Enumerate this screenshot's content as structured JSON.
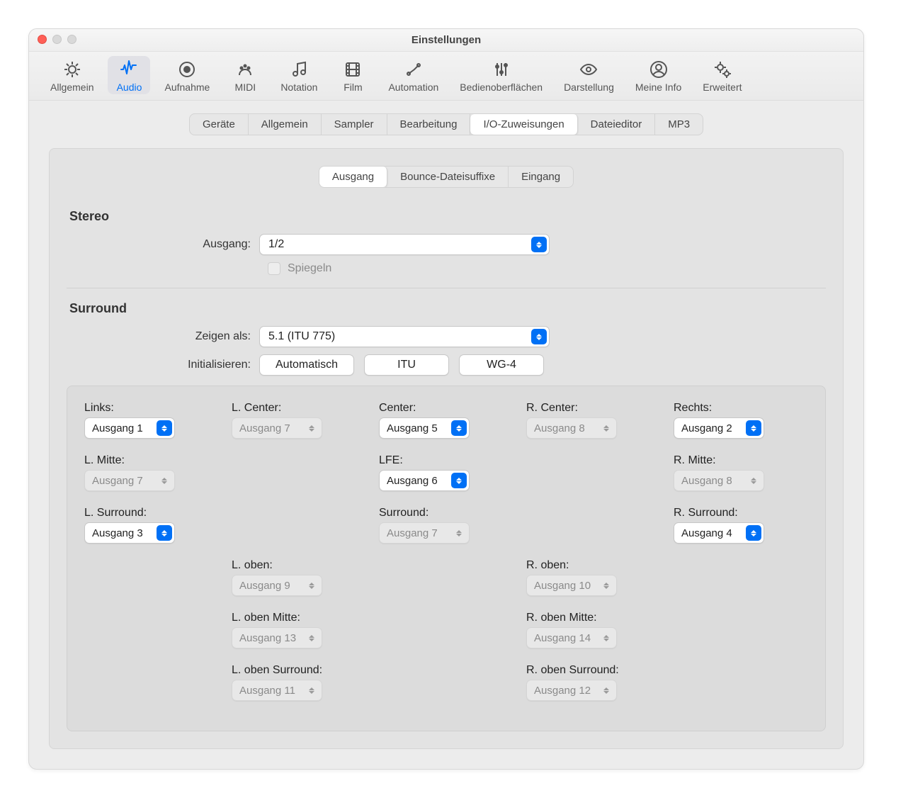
{
  "window": {
    "title": "Einstellungen"
  },
  "toolbar": [
    {
      "id": "allgemein",
      "label": "Allgemein",
      "active": false,
      "icon": "gear"
    },
    {
      "id": "audio",
      "label": "Audio",
      "active": true,
      "icon": "audio"
    },
    {
      "id": "aufnahme",
      "label": "Aufnahme",
      "active": false,
      "icon": "record"
    },
    {
      "id": "midi",
      "label": "MIDI",
      "active": false,
      "icon": "midi"
    },
    {
      "id": "notation",
      "label": "Notation",
      "active": false,
      "icon": "notes"
    },
    {
      "id": "film",
      "label": "Film",
      "active": false,
      "icon": "film"
    },
    {
      "id": "automation",
      "label": "Automation",
      "active": false,
      "icon": "automation"
    },
    {
      "id": "surfaces",
      "label": "Bedienoberflächen",
      "active": false,
      "icon": "sliders"
    },
    {
      "id": "display",
      "label": "Darstellung",
      "active": false,
      "icon": "eye"
    },
    {
      "id": "myinfo",
      "label": "Meine Info",
      "active": false,
      "icon": "user"
    },
    {
      "id": "advanced",
      "label": "Erweitert",
      "active": false,
      "icon": "gears"
    }
  ],
  "tabs1": [
    {
      "label": "Geräte",
      "active": false
    },
    {
      "label": "Allgemein",
      "active": false
    },
    {
      "label": "Sampler",
      "active": false
    },
    {
      "label": "Bearbeitung",
      "active": false
    },
    {
      "label": "I/O-Zuweisungen",
      "active": true
    },
    {
      "label": "Dateieditor",
      "active": false
    },
    {
      "label": "MP3",
      "active": false
    }
  ],
  "tabs2": [
    {
      "label": "Ausgang",
      "active": true
    },
    {
      "label": "Bounce-Dateisuffixe",
      "active": false
    },
    {
      "label": "Eingang",
      "active": false
    }
  ],
  "stereo": {
    "heading": "Stereo",
    "output_label": "Ausgang:",
    "output_value": "1/2",
    "mirror_label": "Spiegeln"
  },
  "surround": {
    "heading": "Surround",
    "show_as_label": "Zeigen als:",
    "show_as_value": "5.1 (ITU 775)",
    "init_label": "Initialisieren:",
    "init_buttons": [
      "Automatisch",
      "ITU",
      "WG-4"
    ],
    "channels": {
      "links": {
        "label": "Links:",
        "value": "Ausgang 1",
        "enabled": true
      },
      "lcenter": {
        "label": "L. Center:",
        "value": "Ausgang 7",
        "enabled": false
      },
      "center": {
        "label": "Center:",
        "value": "Ausgang 5",
        "enabled": true
      },
      "rcenter": {
        "label": "R. Center:",
        "value": "Ausgang 8",
        "enabled": false
      },
      "rechts": {
        "label": "Rechts:",
        "value": "Ausgang 2",
        "enabled": true
      },
      "lmitte": {
        "label": "L. Mitte:",
        "value": "Ausgang 7",
        "enabled": false
      },
      "lfe": {
        "label": "LFE:",
        "value": "Ausgang 6",
        "enabled": true
      },
      "rmitte": {
        "label": "R. Mitte:",
        "value": "Ausgang 8",
        "enabled": false
      },
      "lsurr": {
        "label": "L. Surround:",
        "value": "Ausgang 3",
        "enabled": true
      },
      "surr": {
        "label": "Surround:",
        "value": "Ausgang 7",
        "enabled": false
      },
      "rsurr": {
        "label": "R. Surround:",
        "value": "Ausgang 4",
        "enabled": true
      },
      "loben": {
        "label": "L. oben:",
        "value": "Ausgang 9",
        "enabled": false
      },
      "roben": {
        "label": "R. oben:",
        "value": "Ausgang 10",
        "enabled": false
      },
      "lobenm": {
        "label": "L. oben Mitte:",
        "value": "Ausgang 13",
        "enabled": false
      },
      "robenm": {
        "label": "R. oben Mitte:",
        "value": "Ausgang 14",
        "enabled": false
      },
      "lobens": {
        "label": "L. oben Surround:",
        "value": "Ausgang 11",
        "enabled": false
      },
      "robens": {
        "label": "R. oben Surround:",
        "value": "Ausgang 12",
        "enabled": false
      }
    }
  }
}
